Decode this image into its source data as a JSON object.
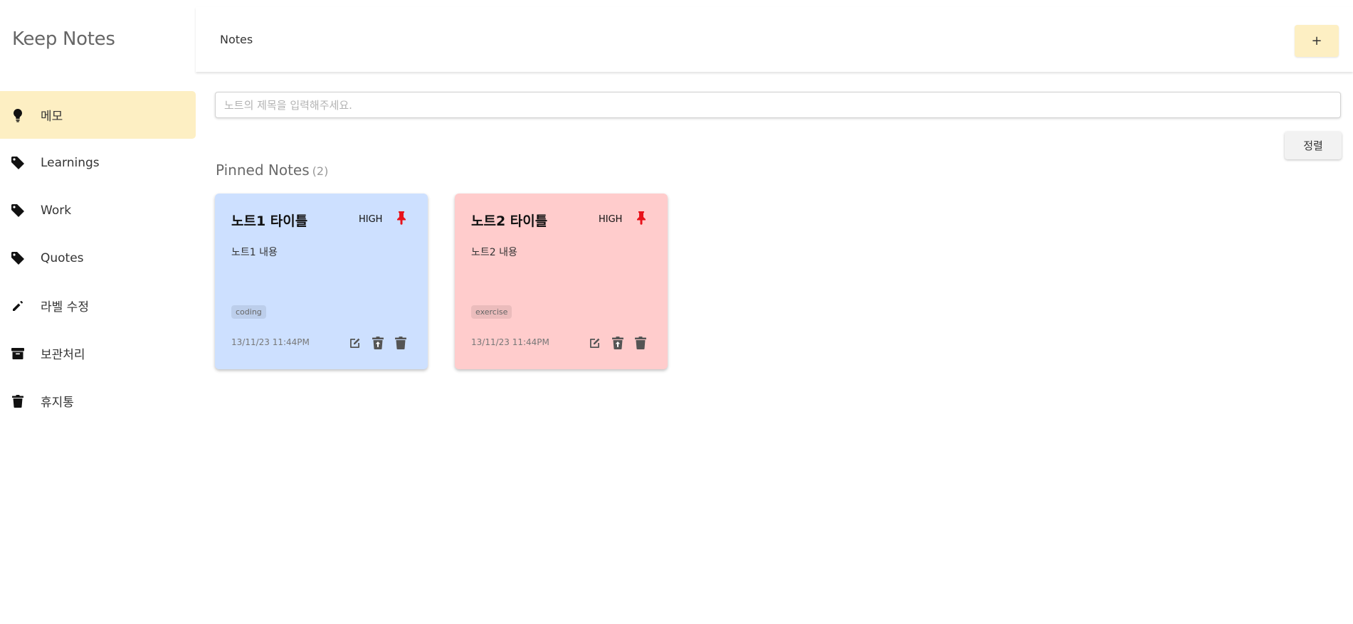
{
  "app": {
    "brand": "Keep Notes"
  },
  "sidebar": {
    "items": [
      {
        "label": "메모",
        "icon": "lightbulb-icon",
        "active": true
      },
      {
        "label": "Learnings",
        "icon": "tag-icon"
      },
      {
        "label": "Work",
        "icon": "tag-icon"
      },
      {
        "label": "Quotes",
        "icon": "tag-icon"
      },
      {
        "label": "라벨 수정",
        "icon": "pencil-icon"
      },
      {
        "label": "보관처리",
        "icon": "archive-icon"
      },
      {
        "label": "휴지통",
        "icon": "trash-icon"
      }
    ],
    "active_color": "#fdefc3"
  },
  "header": {
    "title": "Notes",
    "add_label": "+"
  },
  "search": {
    "placeholder": "노트의 제목을 입력해주세요.",
    "value": ""
  },
  "sort": {
    "label": "정렬"
  },
  "pinned": {
    "title": "Pinned Notes",
    "count": "(2)",
    "notes": [
      {
        "title": "노트1 타이틀",
        "priority": "HIGH",
        "body": "노트1 내용",
        "tag": "coding",
        "date": "13/11/23 11:44PM",
        "color": "#cde0ff"
      },
      {
        "title": "노트2 타이틀",
        "priority": "HIGH",
        "body": "노트2 내용",
        "tag": "exercise",
        "date": "13/11/23 11:44PM",
        "color": "#ffcccc"
      }
    ]
  },
  "colors": {
    "pin": "#e8131b",
    "accent": "#fdefc3"
  }
}
